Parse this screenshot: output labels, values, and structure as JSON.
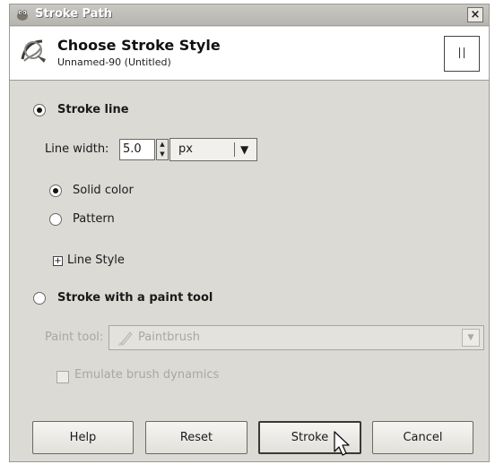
{
  "window": {
    "title": "Stroke Path",
    "close_glyph": "×"
  },
  "header": {
    "title": "Choose Stroke Style",
    "subtitle": "Unnamed-90 (Untitled)",
    "icon": "stroke-path-icon"
  },
  "stroke_line": {
    "label": "Stroke line",
    "selected": true,
    "line_width_label": "Line width:",
    "line_width_value": "5.0",
    "unit_value": "px",
    "fill_options": [
      {
        "label": "Solid color",
        "selected": true
      },
      {
        "label": "Pattern",
        "selected": false
      }
    ],
    "line_style_label": "Line Style",
    "line_style_expander": "+"
  },
  "stroke_paint_tool": {
    "label": "Stroke with a paint tool",
    "selected": false,
    "paint_tool_label": "Paint tool:",
    "paint_tool_value": "Paintbrush",
    "emulate_label": "Emulate brush dynamics",
    "emulate_checked": false
  },
  "buttons": {
    "help": "Help",
    "reset": "Reset",
    "stroke": "Stroke",
    "cancel": "Cancel"
  },
  "colors": {
    "dialog_bg": "#dcdad5",
    "header_bg": "#ffffff",
    "disabled_text": "#a9a7a2"
  }
}
